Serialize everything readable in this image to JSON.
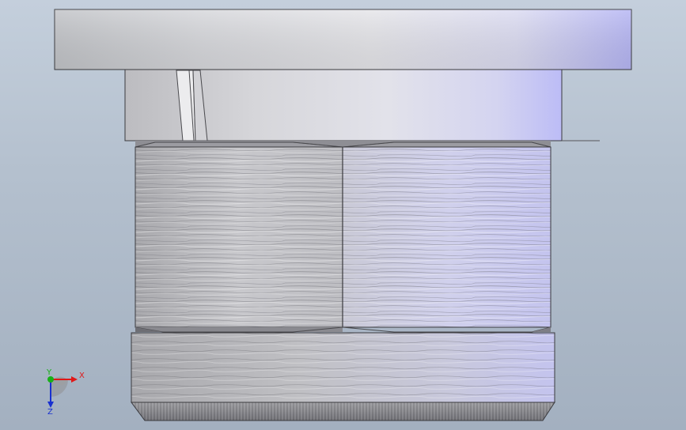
{
  "viewport": {
    "background_top": "#c4cfdc",
    "background_bottom": "#a3b0c0"
  },
  "triad": {
    "x_label": "X",
    "y_label": "Y",
    "z_label": "Z",
    "x_color": "#e01818",
    "y_color": "#18b018",
    "z_color": "#1830d0"
  }
}
